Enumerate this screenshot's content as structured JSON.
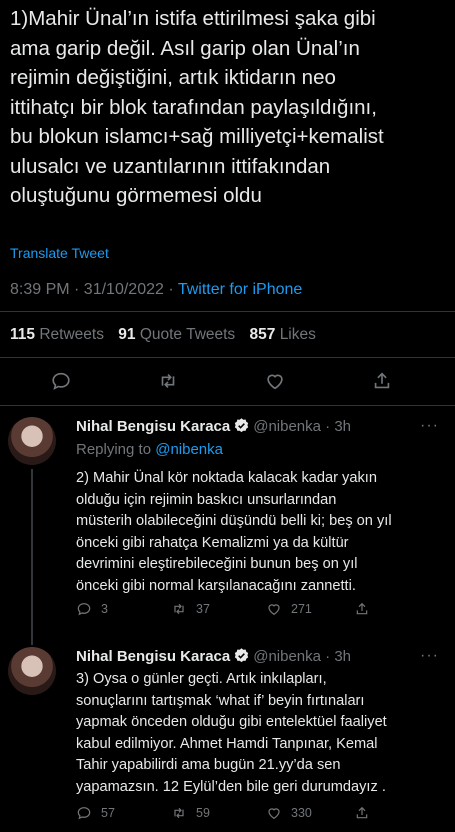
{
  "tweet": {
    "text": "1)Mahir Ünal’ın istifa ettirilmesi şaka gibi\nama  garip değil. Asıl garip olan Ünal’ın\nrejimin değiştiğini, artık iktidarın neo\nittihatçı bir blok tarafından paylaşıldığını,\nbu blokun islamcı+sağ milliyetçi+kemalist\nulusalcı ve uzantılarının ittifakından\noluştuğunu görmemesi oldu",
    "translate_label": "Translate Tweet",
    "time": "8:39 PM · 31/10/2022 · ",
    "source": "Twitter for iPhone",
    "stats": {
      "retweets_count": "115",
      "retweets_label": "Retweets",
      "quotes_count": "91",
      "quotes_label": "Quote Tweets",
      "likes_count": "857",
      "likes_label": "Likes"
    }
  },
  "replies": [
    {
      "name": "Nihal Bengisu Karaca",
      "handle": "@nibenka · 3h",
      "more": "···",
      "replying_prefix": "Replying to ",
      "replying_handle": "@nibenka",
      "text": "2) Mahir Ünal kör noktada kalacak kadar yakın\nolduğu için rejimin baskıcı unsurlarından\nmüsterih olabileceğini düşündü belli ki; beş on yıl\nönceki gibi rahatça Kemalizmi ya da kültür\ndevrimini eleştirebileceğini bunun beş on yıl\nönceki gibi normal karşılanacağını zannetti.",
      "replies": "3",
      "retweets": "37",
      "likes": "271"
    },
    {
      "name": "Nihal Bengisu Karaca",
      "handle": "@nibenka · 3h",
      "more": "···",
      "text": "3) Oysa o günler geçti. Artık inkılapları,\nsonuçlarını tartışmak ‘what if’ beyin fırtınaları\nyapmak önceden olduğu gibi entelektüel faaliyet\nkabul edilmiyor. Ahmet Hamdi Tanpınar, Kemal\nTahir yapabilirdi ama bugün 21.yy’da sen\nyapamazsın. 12 Eylül’den bile geri durumdayız .",
      "replies": "57",
      "retweets": "59",
      "likes": "330"
    }
  ],
  "colors": {
    "accent": "#1d9bf0",
    "muted": "#71767b",
    "text": "#e7e9ea",
    "background": "#000000"
  }
}
